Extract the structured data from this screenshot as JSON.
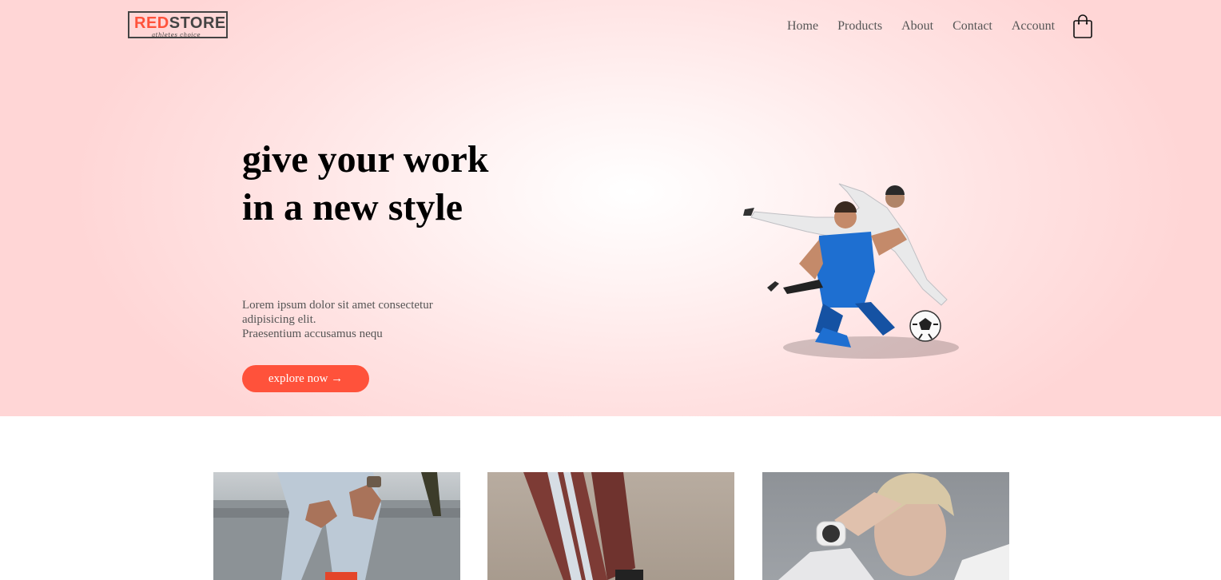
{
  "logo": {
    "red_part": "RED",
    "dark_part": "STORE",
    "tagline": "athletes choice"
  },
  "nav": {
    "items": [
      "Home",
      "Products",
      "About",
      "Contact",
      "Account"
    ],
    "cart_icon": "shopping-bag-icon"
  },
  "hero": {
    "title": "give your work in a new style",
    "description_lines": [
      "Lorem ipsum dolor sit amet consectetur",
      "adipisicing elit.",
      "Praesentium accusamus nequ"
    ],
    "button_label": "explore now →",
    "image": "football-players-illustration"
  },
  "categories": [
    {
      "image": "ripped-jeans-sneakers-photo"
    },
    {
      "image": "track-pants-photo"
    },
    {
      "image": "smartwatch-woman-photo"
    }
  ],
  "colors": {
    "accent": "#ff523b",
    "hero_bg": "#ffd6d6",
    "text": "#555555"
  }
}
